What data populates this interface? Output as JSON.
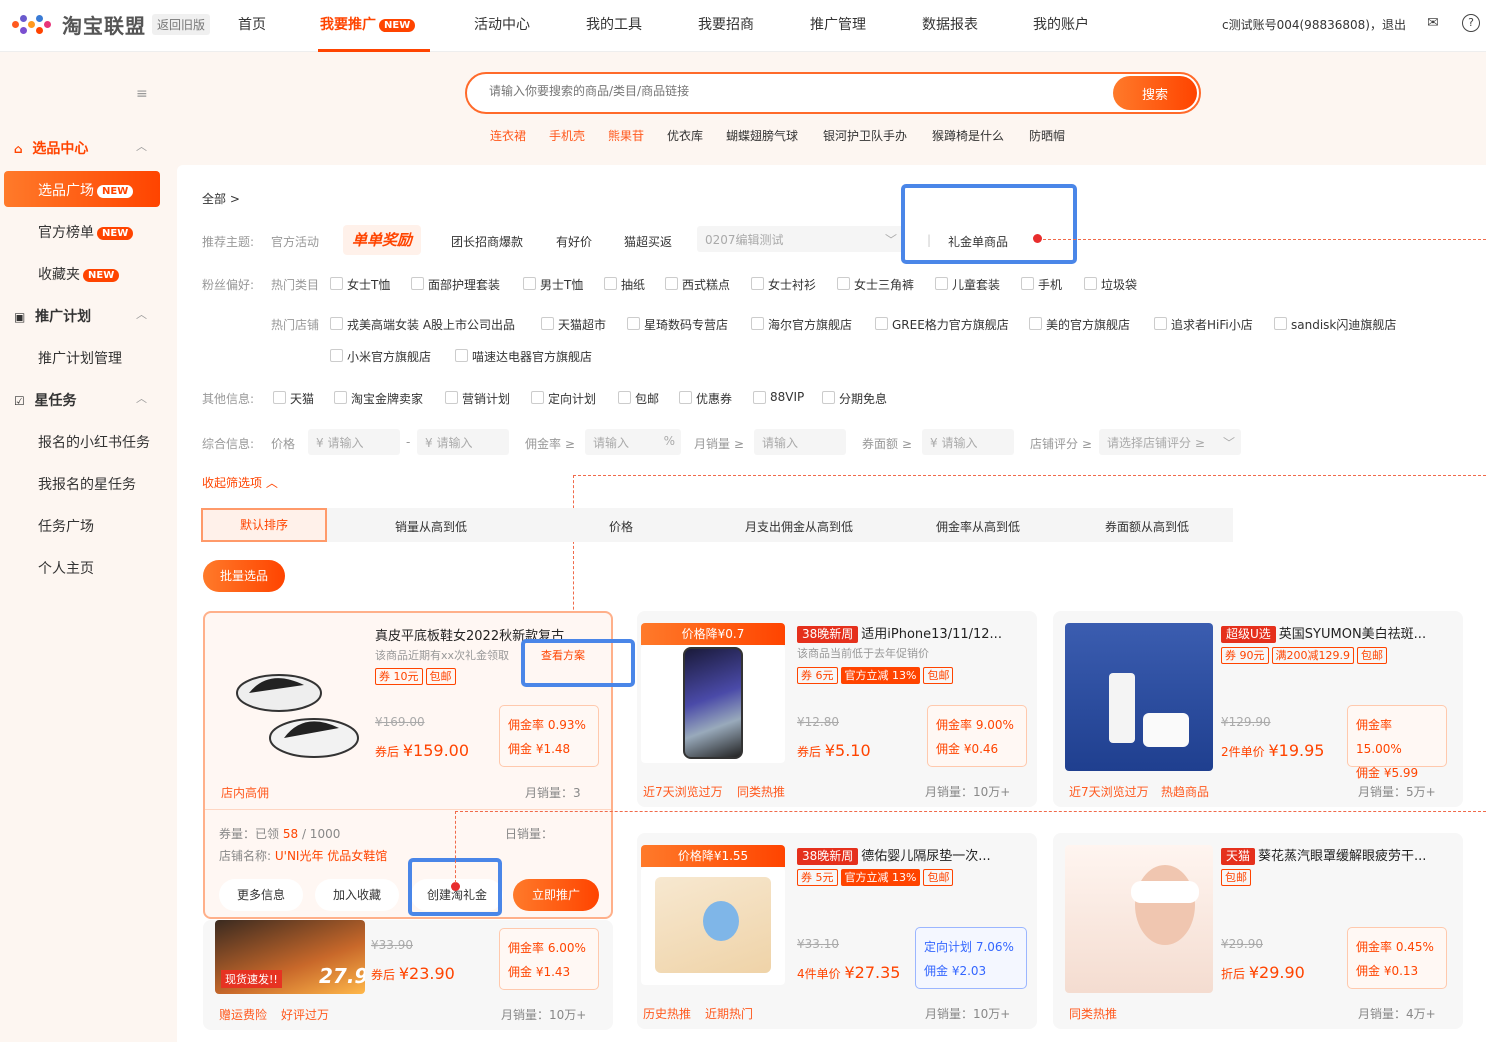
{
  "nav": {
    "logo": "淘宝联盟",
    "old_version": "返回旧版",
    "items": [
      "首页",
      "我要推广",
      "活动中心",
      "我的工具",
      "我要招商",
      "推广管理",
      "数据报表",
      "我的账户"
    ],
    "new_badge": "NEW",
    "account": "c测试账号004(98836808)，退出",
    "icons": [
      "mail-icon",
      "help-icon"
    ]
  },
  "search": {
    "placeholder": "请输入你要搜索的商品/类目/商品链接",
    "button": "搜索",
    "hotwords": [
      "连衣裙",
      "手机壳",
      "熊果苷",
      "优衣库",
      "蝴蝶翅膀气球",
      "银河护卫队手办",
      "猴蹲椅是什么",
      "防晒帽"
    ]
  },
  "sidebar": {
    "groups": [
      {
        "label": "选品中心",
        "items": [
          "选品广场",
          "官方榜单",
          "收藏夹"
        ]
      },
      {
        "label": "推广计划",
        "items": [
          "推广计划管理"
        ]
      },
      {
        "label": "星任务",
        "items": [
          "报名的小红书任务",
          "我报名的星任务",
          "任务广场",
          "个人主页"
        ]
      }
    ],
    "new_badge": "NEW"
  },
  "filters": {
    "breadcrumb": "全部 >",
    "theme_label": "推荐主题:",
    "theme_official": "官方活动",
    "theme_items": [
      "单单奖励",
      "团长招商爆款",
      "有好价",
      "猫超买返"
    ],
    "theme_select": "0207编辑测试",
    "theme_highlight": "礼金单商品",
    "fans_label": "粉丝偏好:",
    "hot_category_label": "热门类目",
    "hot_categories": [
      "女士T恤",
      "面部护理套装",
      "男士T恤",
      "抽纸",
      "西式糕点",
      "女士衬衫",
      "女士三角裤",
      "儿童套装",
      "手机",
      "垃圾袋"
    ],
    "hot_store_label": "热门店铺",
    "hot_stores": [
      "戎美高端女装 A股上市公司出品",
      "天猫超市",
      "星琦数码专营店",
      "海尔官方旗舰店",
      "GREE格力官方旗舰店",
      "美的官方旗舰店",
      "追求者HiFi小店",
      "sandisk闪迪旗舰店",
      "小米官方旗舰店",
      "喵速达电器官方旗舰店"
    ],
    "other_label": "其他信息:",
    "other_items": [
      "天猫",
      "淘宝金牌卖家",
      "营销计划",
      "定向计划",
      "包邮",
      "优惠券",
      "88VIP",
      "分期免息"
    ],
    "combined_label": "综合信息:",
    "price_label": "价格",
    "price_min": "¥ 请输入",
    "price_dash": "-",
    "price_max": "¥ 请输入",
    "commission_label": "佣金率 ≥",
    "commission_input": "请输入",
    "percent": "%",
    "monthly_label": "月销量 ≥",
    "monthly_input": "请输入",
    "coupon_label": "券面额 ≥",
    "coupon_input": "¥ 请输入",
    "score_label": "店铺评分 ≥",
    "score_select": "请选择店铺评分 ≥",
    "collapse": "收起筛选项"
  },
  "sort": {
    "items": [
      "默认排序",
      "销量从高到低",
      "价格",
      "月支出佣金从高到低",
      "佣金率从高到低",
      "券面额从高到低"
    ],
    "batch": "批量选品"
  },
  "products": [
    {
      "title": "真皮平底板鞋女2022秋新款复古",
      "desc": "该商品近期有xx次礼金领取",
      "link": "查看方案",
      "tags": [
        "券 10元",
        "包邮"
      ],
      "old": "¥169.00",
      "now_label": "券后",
      "now": "¥159.00",
      "rate": "佣金率 0.93%",
      "commission": "佣金 ¥1.48",
      "hot": [
        "店内高佣"
      ],
      "sales": "月销量：3",
      "extra": {
        "quota_label": "券量：已领",
        "quota_used": "58",
        "quota_total": "/ 1000",
        "daily": "日销量：",
        "store_label": "店铺名称:",
        "store": "U'NI光年 优品女鞋馆",
        "btns": [
          "更多信息",
          "加入收藏",
          "创建淘礼金",
          "立即推广"
        ]
      }
    },
    {
      "ribbon": "价格降¥0.7",
      "badge": "38晚新周",
      "title": "适用iPhone13/11/12...",
      "desc": "该商品当前低于去年促销价",
      "tags": [
        "券 6元",
        "官方立减 13%",
        "包邮"
      ],
      "old": "¥12.80",
      "now_label": "券后",
      "now": "¥5.10",
      "rate": "佣金率 9.00%",
      "commission": "佣金 ¥0.46",
      "hot": [
        "近7天浏览过万",
        "同类热推"
      ],
      "sales": "月销量：10万+"
    },
    {
      "badge": "超级U选",
      "title": "英国SYUMON美白祛斑...",
      "tags": [
        "券 90元",
        "满200减129.9",
        "包邮"
      ],
      "old": "¥129.90",
      "now_label": "2件单价",
      "now": "¥19.95",
      "rate": "佣金率 15.00%",
      "commission": "佣金 ¥5.99",
      "hot": [
        "近7天浏览过万",
        "热趋商品"
      ],
      "sales": "月销量：5万+"
    },
    {
      "old": "¥33.90",
      "now_label": "券后",
      "now": "¥23.90",
      "rate": "佣金率 6.00%",
      "commission": "佣金 ¥1.43",
      "hot": [
        "赠运费险",
        "好评过万"
      ],
      "sales": "月销量：10万+",
      "img_text": "现货速发!!",
      "img_price": "27.9"
    },
    {
      "ribbon": "价格降¥1.55",
      "badge": "38晚新周",
      "title": "德佑婴儿隔尿垫一次...",
      "tags": [
        "券 5元",
        "官方立减 13%",
        "包邮"
      ],
      "old": "¥33.10",
      "now_label": "4件单价",
      "now": "¥27.35",
      "rate": "定向计划 7.06%",
      "commission": "佣金 ¥2.03",
      "hot": [
        "历史热推",
        "近期热门"
      ],
      "sales": "月销量：10万+"
    },
    {
      "badge": "天猫",
      "title": "葵花蒸汽眼罩缓解眼疲劳干...",
      "tags": [
        "包邮"
      ],
      "old": "¥29.90",
      "now_label": "折后",
      "now": "¥29.90",
      "rate": "佣金率 0.45%",
      "commission": "佣金 ¥0.13",
      "hot": [
        "同类热推"
      ],
      "sales": "月销量：4万+"
    }
  ]
}
